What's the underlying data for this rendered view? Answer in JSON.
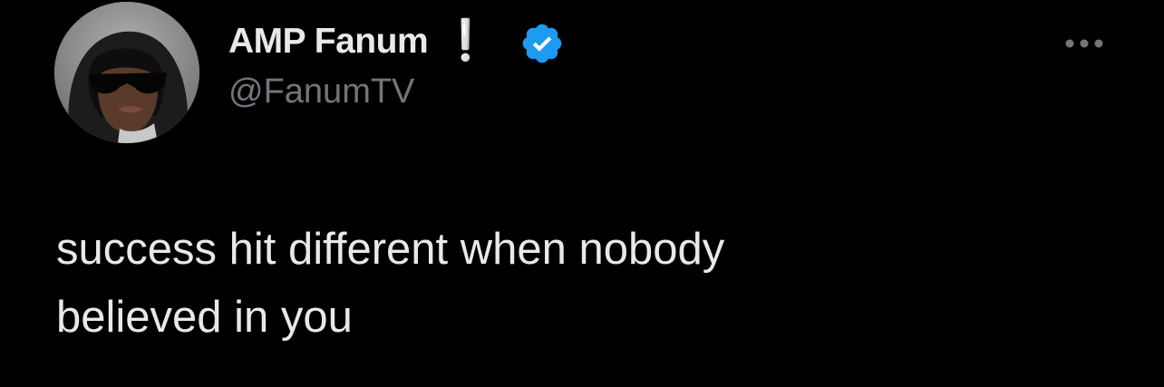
{
  "tweet": {
    "author": {
      "display_name": "AMP Fanum",
      "name_emoji": "❕",
      "handle": "@FanumTV",
      "verified": true
    },
    "text": "success hit different when nobody\nbelieved in you",
    "more_icon": "more-horizontal-icon"
  },
  "colors": {
    "background": "#000000",
    "text_primary": "#e7e9ea",
    "text_secondary": "#71767b",
    "verified_blue": "#1d9bf0"
  }
}
